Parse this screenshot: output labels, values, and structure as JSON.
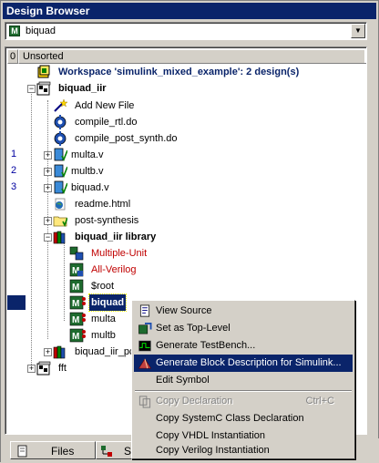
{
  "window": {
    "title": "Design Browser"
  },
  "selector": {
    "value": "biquad",
    "icon": "module-icon"
  },
  "header": {
    "col0": "0",
    "col1": "Unsorted"
  },
  "gutter": {
    "numbers": [
      "1",
      "2",
      "3"
    ]
  },
  "tree": {
    "workspace": "Workspace 'simulink_mixed_example': 2 design(s)",
    "design1": "biquad_iir",
    "add_new_file": "Add New File",
    "compile_rtl": "compile_rtl.do",
    "compile_post": "compile_post_synth.do",
    "multa_v": "multa.v",
    "multb_v": "multb.v",
    "biquad_v": "biquad.v",
    "readme": "readme.html",
    "post_synth": "post-synthesis",
    "library": "biquad_iir library",
    "multiple_unit": "Multiple-Unit",
    "all_verilog": "All-Verilog",
    "root": "$root",
    "biquad": "biquad",
    "multa": "multa",
    "multb": "multb",
    "biquad_iir_pc": "biquad_iir_pc",
    "fft": "fft"
  },
  "tabs": {
    "files": "Files",
    "second": "S"
  },
  "context_menu": {
    "view_source": "View Source",
    "set_top": "Set as Top-Level",
    "gen_testbench": "Generate TestBench...",
    "gen_block": "Generate Block Description for Simulink...",
    "edit_symbol": "Edit Symbol",
    "copy_decl": "Copy Declaration",
    "copy_decl_accel": "Ctrl+C",
    "copy_systemc": "Copy SystemC Class Declaration",
    "copy_vhdl": "Copy VHDL Instantiation",
    "copy_verilog": "Copy Verilog Instantiation"
  },
  "colors": {
    "selection": "#0a246a",
    "title": "#0a246a",
    "red_item": "#c00000",
    "face": "#d4d0c8"
  }
}
